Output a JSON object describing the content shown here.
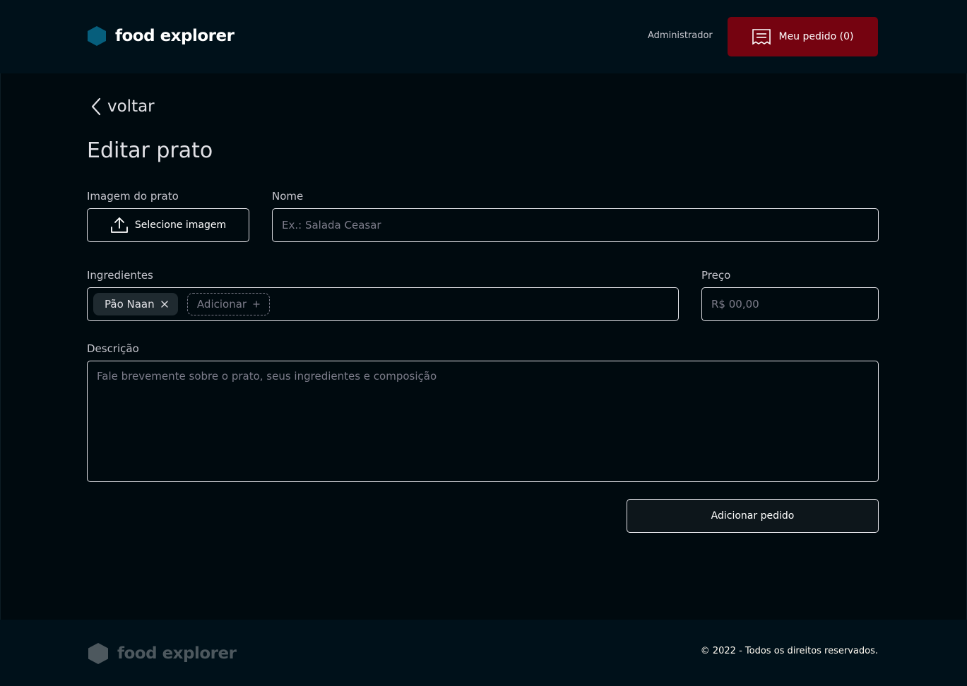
{
  "header": {
    "brand_name": "food explorer",
    "user_role": "Administrador",
    "order_button_label": "Meu pedido (0)"
  },
  "nav": {
    "back_label": "voltar"
  },
  "page": {
    "title": "Editar prato"
  },
  "form": {
    "image": {
      "label": "Imagem do prato",
      "button_label": "Selecione imagem"
    },
    "name": {
      "label": "Nome",
      "placeholder": "Ex.: Salada Ceasar",
      "value": ""
    },
    "ingredients": {
      "label": "Ingredientes",
      "items": [
        "Pão Naan"
      ],
      "add_label": "Adicionar"
    },
    "price": {
      "label": "Preço",
      "placeholder": "R$ 00,00",
      "value": ""
    },
    "description": {
      "label": "Descrição",
      "placeholder": "Fale brevemente sobre o prato, seus ingredientes e composição",
      "value": ""
    },
    "submit_label": "Adicionar pedido"
  },
  "footer": {
    "brand_name": "food explorer",
    "copyright": "© 2022 - Todos os direitos reservados."
  },
  "colors": {
    "background": "#000A0F",
    "header": "#00111A",
    "accent_red": "#750310",
    "logo_blue": "#065E7C",
    "footer_logo": "#4D585E"
  }
}
